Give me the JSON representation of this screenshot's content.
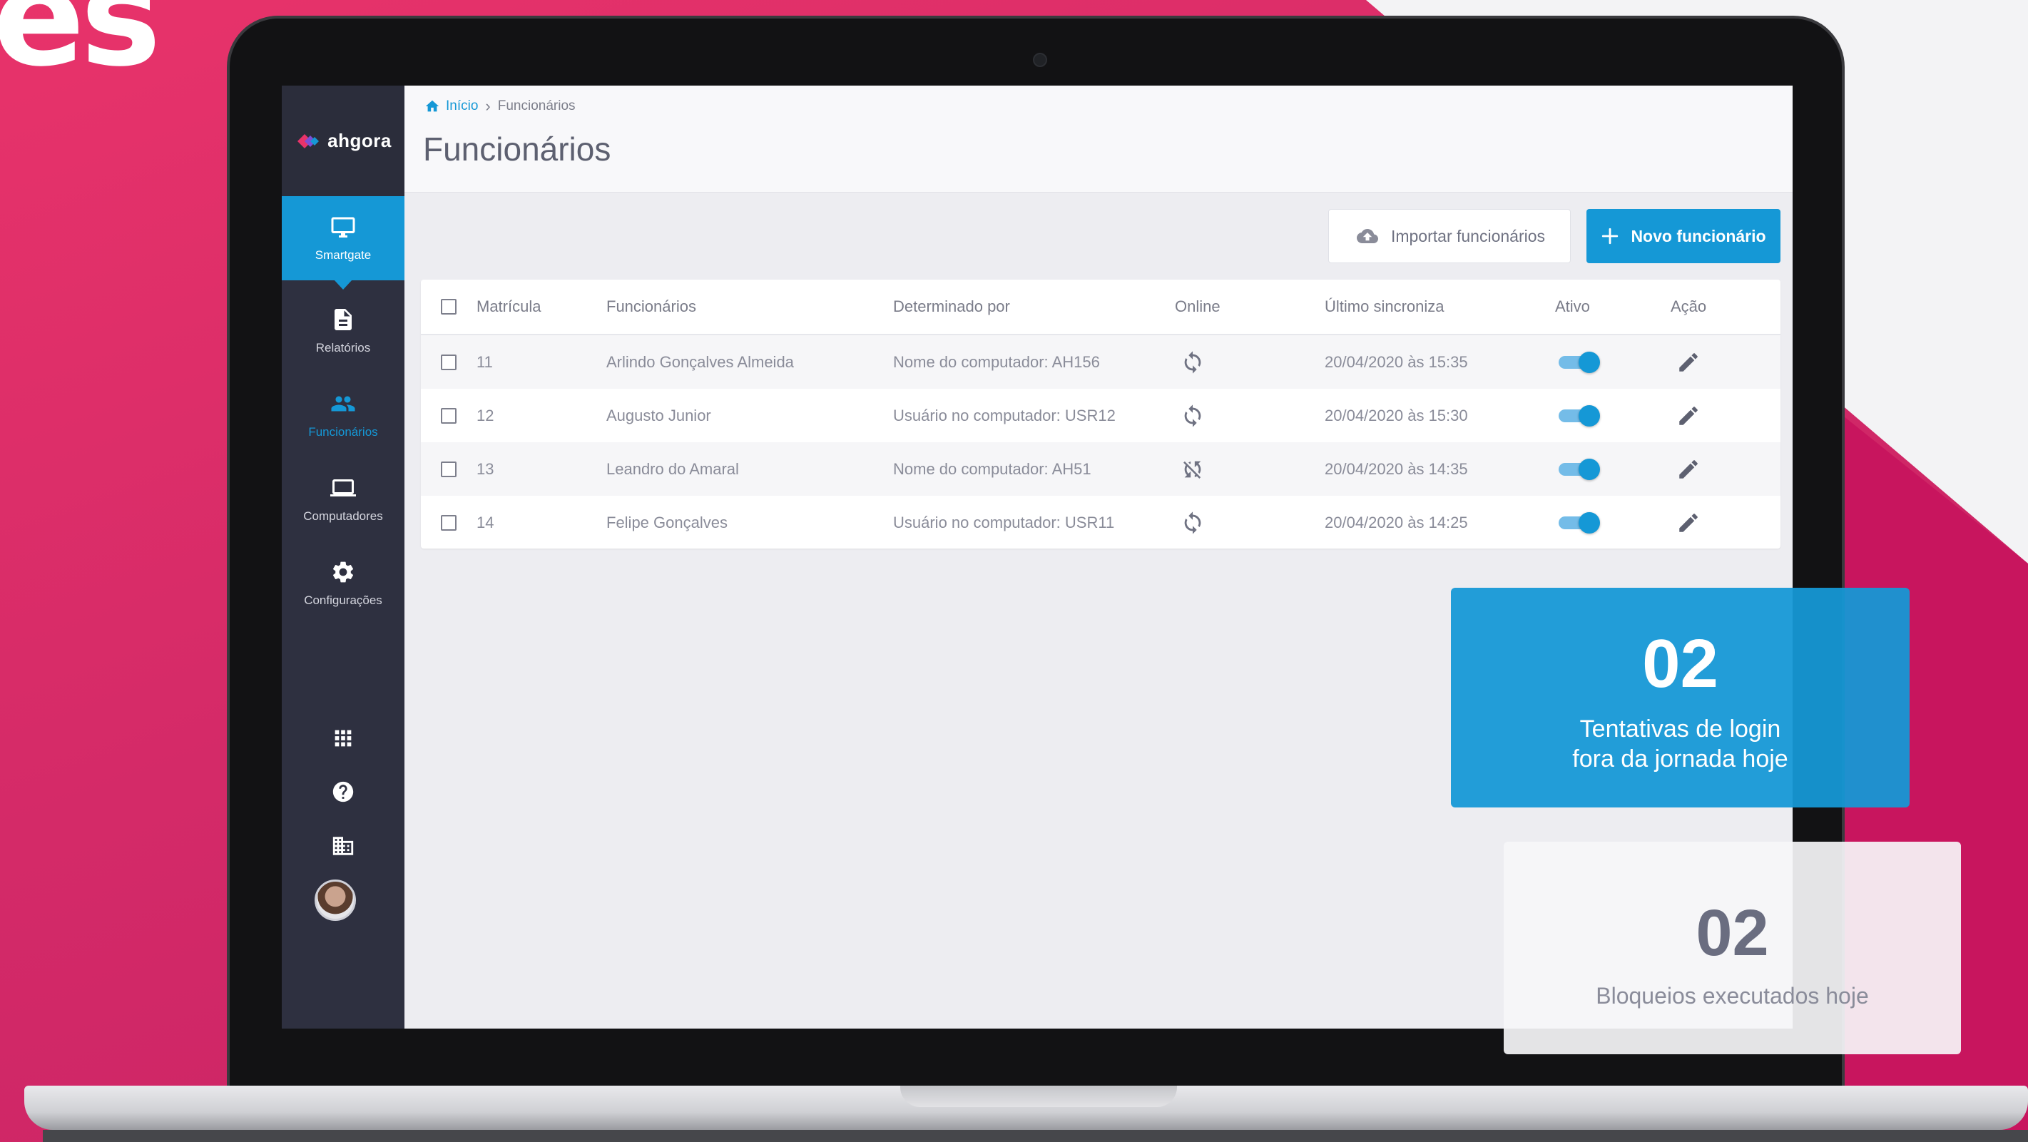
{
  "marketing": {
    "headline_fragment": "es"
  },
  "brand": {
    "name": "ahgora",
    "accent": "#1598d6",
    "sidebar_bg": "#2e3040",
    "background_pink": "#d42a68"
  },
  "sidebar": {
    "items": [
      {
        "label": "Smartgate",
        "icon": "monitor-icon",
        "state": "active"
      },
      {
        "label": "Relatórios",
        "icon": "document-icon",
        "state": "normal"
      },
      {
        "label": "Funcionários",
        "icon": "people-icon",
        "state": "selected"
      },
      {
        "label": "Computadores",
        "icon": "laptop-icon",
        "state": "normal"
      },
      {
        "label": "Configurações",
        "icon": "gear-icon",
        "state": "normal"
      }
    ],
    "bottom_icons": [
      "apps-grid-icon",
      "help-icon",
      "building-icon",
      "avatar"
    ]
  },
  "breadcrumb": {
    "home": "Início",
    "current": "Funcionários"
  },
  "page": {
    "title": "Funcionários"
  },
  "toolbar": {
    "import_label": "Importar funcionários",
    "new_label": "Novo funcionário"
  },
  "table": {
    "columns": [
      "Matrícula",
      "Funcionários",
      "Determinado por",
      "Online",
      "Último sincroniza",
      "Ativo",
      "Ação"
    ],
    "rows": [
      {
        "id": "11",
        "name": "Arlindo Gonçalves Almeida",
        "determined_by": "Nome do computador: AH156",
        "online": "sync-icon",
        "last_sync": "20/04/2020 às 15:35",
        "active": true
      },
      {
        "id": "12",
        "name": "Augusto Junior",
        "determined_by": "Usuário no computador: USR12",
        "online": "sync-icon",
        "last_sync": "20/04/2020 às 15:30",
        "active": true
      },
      {
        "id": "13",
        "name": "Leandro do Amaral",
        "determined_by": "Nome do computador: AH51",
        "online": "sync-off-icon",
        "last_sync": "20/04/2020 às 14:35",
        "active": true
      },
      {
        "id": "14",
        "name": "Felipe Gonçalves",
        "determined_by": "Usuário no computador: USR11",
        "online": "sync-icon",
        "last_sync": "20/04/2020 às 14:25",
        "active": true
      }
    ]
  },
  "cards": {
    "login_attempts": {
      "value": "02",
      "label": "Tentativas de login fora da jornada hoje"
    },
    "blocks": {
      "value": "02",
      "label": "Bloqueios executados hoje"
    }
  }
}
